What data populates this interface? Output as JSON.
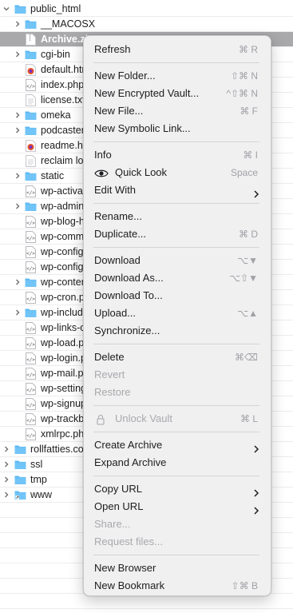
{
  "files": [
    {
      "name": "public_html",
      "type": "folder",
      "expanded": true
    },
    {
      "name": "__MACOSX",
      "type": "folder"
    },
    {
      "name": "Archive.zip",
      "type": "zip"
    },
    {
      "name": "cgi-bin",
      "type": "folder"
    },
    {
      "name": "default.htm",
      "type": "html-special"
    },
    {
      "name": "index.php",
      "type": "code"
    },
    {
      "name": "license.txt",
      "type": "text"
    },
    {
      "name": "omeka",
      "type": "folder"
    },
    {
      "name": "podcaster",
      "type": "folder"
    },
    {
      "name": "readme.html",
      "type": "html-special"
    },
    {
      "name": "reclaim log",
      "type": "text"
    },
    {
      "name": "static",
      "type": "folder"
    },
    {
      "name": "wp-activate.php",
      "type": "code"
    },
    {
      "name": "wp-admin",
      "type": "folder"
    },
    {
      "name": "wp-blog-header.php",
      "type": "code"
    },
    {
      "name": "wp-comments-post.php",
      "type": "code"
    },
    {
      "name": "wp-config-sample.php",
      "type": "code"
    },
    {
      "name": "wp-config.php",
      "type": "code"
    },
    {
      "name": "wp-content",
      "type": "folder"
    },
    {
      "name": "wp-cron.php",
      "type": "code"
    },
    {
      "name": "wp-includes",
      "type": "folder"
    },
    {
      "name": "wp-links-opml.php",
      "type": "code"
    },
    {
      "name": "wp-load.php",
      "type": "code"
    },
    {
      "name": "wp-login.php",
      "type": "code"
    },
    {
      "name": "wp-mail.php",
      "type": "code"
    },
    {
      "name": "wp-settings.php",
      "type": "code"
    },
    {
      "name": "wp-signup.php",
      "type": "code"
    },
    {
      "name": "wp-trackback.php",
      "type": "code"
    },
    {
      "name": "xmlrpc.php",
      "type": "code"
    },
    {
      "name": "rollfatties.com",
      "type": "folder"
    },
    {
      "name": "ssl",
      "type": "folder"
    },
    {
      "name": "tmp",
      "type": "folder"
    },
    {
      "name": "www",
      "type": "folder-link"
    }
  ],
  "menu": {
    "refresh": {
      "label": "Refresh",
      "shortcut": "⌘ R"
    },
    "new_folder": {
      "label": "New Folder...",
      "shortcut": "⇧⌘ N"
    },
    "new_encrypted_vault": {
      "label": "New Encrypted Vault...",
      "shortcut": "^⇧⌘ N"
    },
    "new_file": {
      "label": "New File...",
      "shortcut": "⌘ F"
    },
    "new_symbolic_link": {
      "label": "New Symbolic Link..."
    },
    "info": {
      "label": "Info",
      "shortcut": "⌘ I"
    },
    "quick_look": {
      "label": "Quick Look",
      "shortcut": "Space"
    },
    "edit_with": {
      "label": "Edit With"
    },
    "rename": {
      "label": "Rename..."
    },
    "duplicate": {
      "label": "Duplicate...",
      "shortcut": "⌘ D"
    },
    "download": {
      "label": "Download",
      "shortcut": "⌥▼"
    },
    "download_as": {
      "label": "Download As...",
      "shortcut": "⌥⇧▼"
    },
    "download_to": {
      "label": "Download To..."
    },
    "upload": {
      "label": "Upload...",
      "shortcut": "⌥▲"
    },
    "synchronize": {
      "label": "Synchronize..."
    },
    "delete": {
      "label": "Delete",
      "shortcut": "⌘⌫"
    },
    "revert": {
      "label": "Revert"
    },
    "restore": {
      "label": "Restore"
    },
    "unlock_vault": {
      "label": "Unlock Vault",
      "shortcut": "⌘ L"
    },
    "create_archive": {
      "label": "Create Archive"
    },
    "expand_archive": {
      "label": "Expand Archive"
    },
    "copy_url": {
      "label": "Copy URL"
    },
    "open_url": {
      "label": "Open URL"
    },
    "share": {
      "label": "Share..."
    },
    "request_files": {
      "label": "Request files..."
    },
    "new_browser": {
      "label": "New Browser"
    },
    "new_bookmark": {
      "label": "New Bookmark",
      "shortcut": "⇧⌘ B"
    }
  },
  "colors": {
    "folder": "#5bb8f5",
    "selection": "#a9a9ab",
    "menu_bg": "#f0f0f1",
    "disabled_text": "#a9a9ad",
    "shortcut_text": "#a1a1a6"
  }
}
